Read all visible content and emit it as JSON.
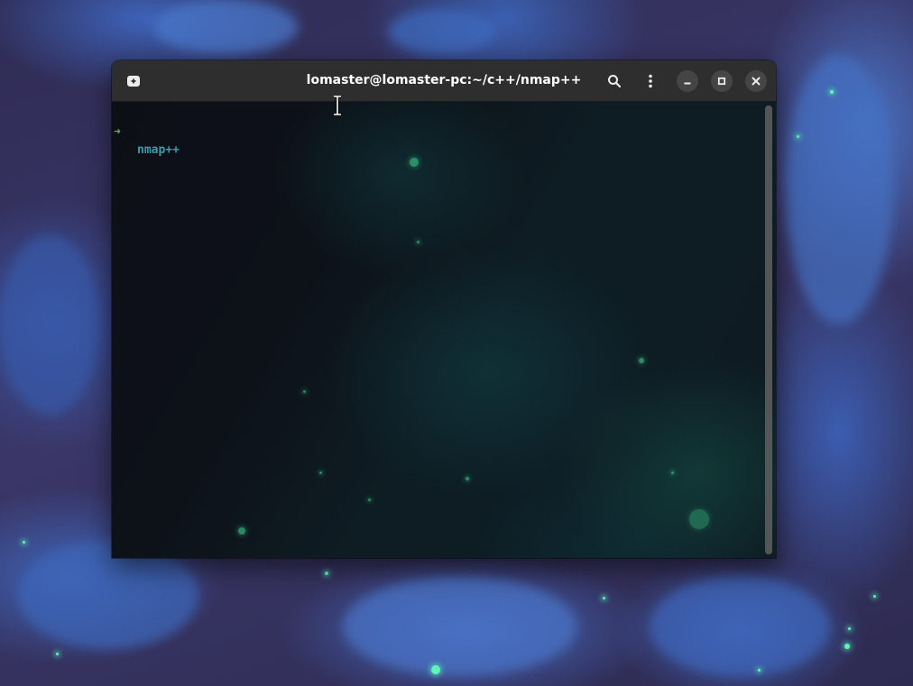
{
  "window": {
    "title": "lomaster@lomaster-pc:~/c++/nmap++"
  },
  "toolbar": {
    "new_tab_icon": "new-tab-icon",
    "search_icon": "search-icon",
    "menu_icon": "kebab-menu-icon",
    "minimize_icon": "minimize-icon",
    "maximize_icon": "maximize-icon",
    "close_icon": "close-icon"
  },
  "terminal": {
    "prompt_symbol": "➜",
    "current_directory": "nmap++",
    "colors": {
      "prompt_symbol": "#58b548",
      "directory": "#3e9ca8",
      "background": "#0d1118"
    }
  }
}
